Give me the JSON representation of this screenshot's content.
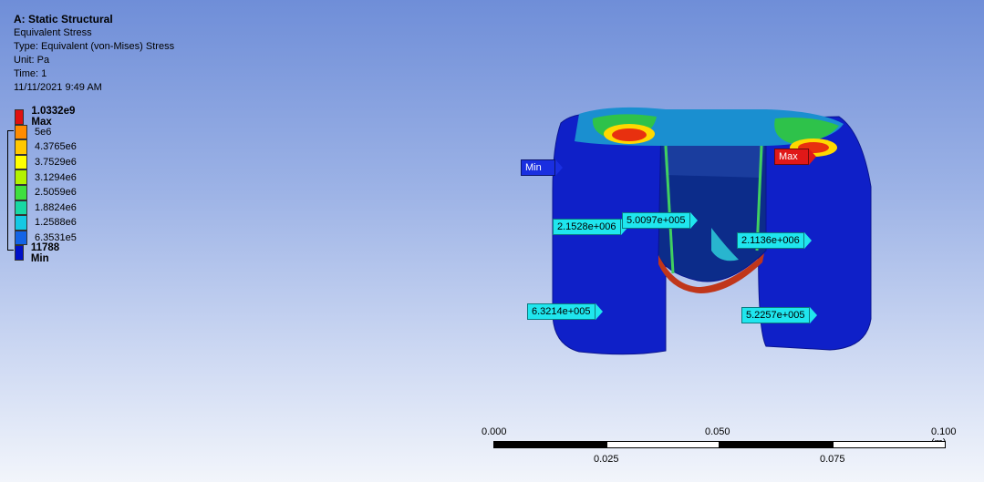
{
  "info": {
    "title": "A: Static Structural",
    "result": "Equivalent Stress",
    "type": "Type: Equivalent (von-Mises) Stress",
    "unit": "Unit: Pa",
    "time": "Time: 1",
    "date": "11/11/2021 9:49 AM"
  },
  "legend": {
    "rows": [
      {
        "label": "1.0332e9 Max",
        "color": "#e0100f"
      },
      {
        "label": "5e6",
        "color": "#ff8c00"
      },
      {
        "label": "4.3765e6",
        "color": "#ffc800"
      },
      {
        "label": "3.7529e6",
        "color": "#ffff00"
      },
      {
        "label": "3.1294e6",
        "color": "#b2f200"
      },
      {
        "label": "2.5059e6",
        "color": "#3fdf3f"
      },
      {
        "label": "1.8824e6",
        "color": "#18d8a4"
      },
      {
        "label": "1.2588e6",
        "color": "#14c8e4"
      },
      {
        "label": "6.3531e5",
        "color": "#1464e6"
      },
      {
        "label": "11788 Min",
        "color": "#0010c8"
      }
    ]
  },
  "probes": {
    "p1": "2.1528e+006",
    "p2": "5.0097e+005",
    "p3": "2.1136e+006",
    "p4": "6.3214e+005",
    "p5": "5.2257e+005"
  },
  "tags": {
    "min": "Min",
    "max": "Max"
  },
  "scalebar": {
    "top": [
      "0.000",
      "0.050",
      "0.100 (m)"
    ],
    "bottom": [
      "0.025",
      "0.075"
    ]
  }
}
